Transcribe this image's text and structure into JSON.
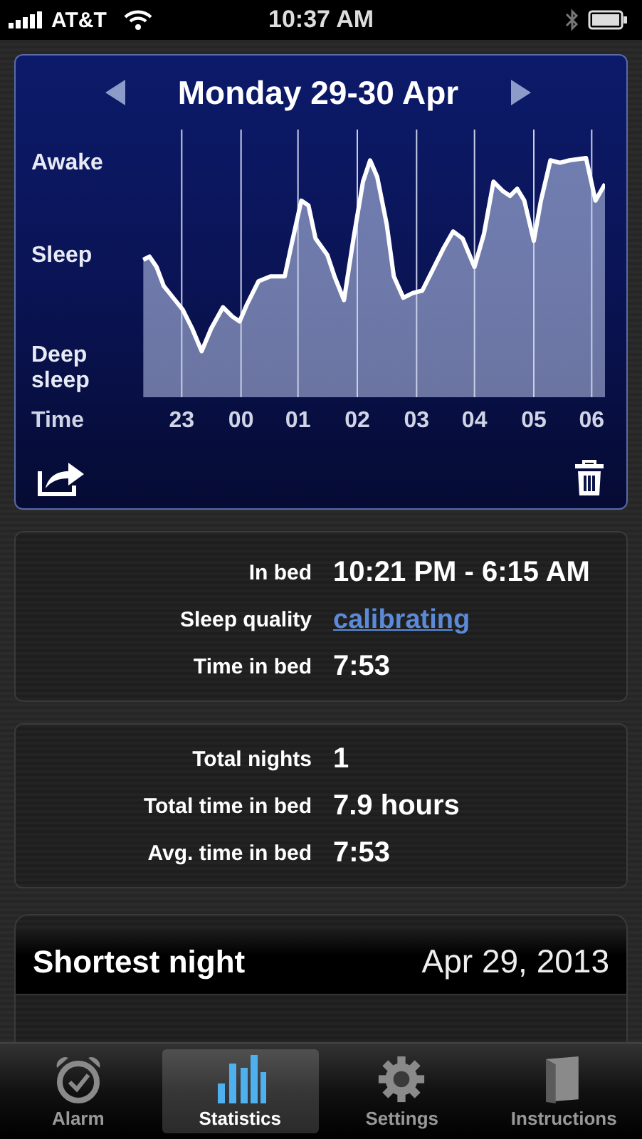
{
  "status_bar": {
    "carrier": "AT&T",
    "time": "10:37 AM"
  },
  "chart_card": {
    "title": "Monday 29-30 Apr",
    "y_labels": [
      "Awake",
      "Sleep",
      "Deep sleep"
    ],
    "x_label": "Time",
    "x_ticks": [
      "23",
      "00",
      "01",
      "02",
      "03",
      "04",
      "05",
      "06"
    ]
  },
  "night_summary": [
    {
      "label": "In bed",
      "value": "10:21 PM - 6:15 AM",
      "kind": "text"
    },
    {
      "label": "Sleep quality",
      "value": "calibrating",
      "kind": "link"
    },
    {
      "label": "Time in bed",
      "value": "7:53",
      "kind": "text"
    }
  ],
  "totals": [
    {
      "label": "Total nights",
      "value": "1"
    },
    {
      "label": "Total time in bed",
      "value": "7.9 hours"
    },
    {
      "label": "Avg. time in bed",
      "value": "7:53"
    }
  ],
  "shortest_night": {
    "label": "Shortest night",
    "value": "Apr 29, 2013"
  },
  "tabs": [
    {
      "label": "Alarm",
      "selected": false,
      "kind": "alarm"
    },
    {
      "label": "Statistics",
      "selected": true,
      "kind": "statistics"
    },
    {
      "label": "Settings",
      "selected": false,
      "kind": "settings"
    },
    {
      "label": "Instructions",
      "selected": false,
      "kind": "instructions"
    }
  ]
}
